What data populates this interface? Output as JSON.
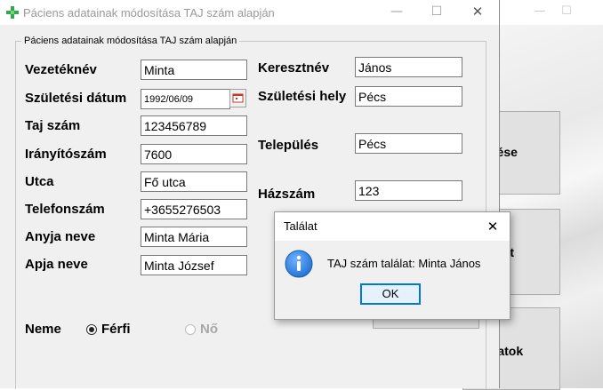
{
  "background_window": {
    "buttons": [
      {
        "label": "zítése"
      },
      {
        "label": "xport"
      },
      {
        "label": "adatok"
      }
    ]
  },
  "dialog": {
    "title": "Páciens adatainak módosítása TAJ szám alapján",
    "group_title": "Páciens adatainak módosítása TAJ szám alapján",
    "fields": {
      "vezeteknev": {
        "label": "Vezetéknév",
        "value": "Minta"
      },
      "szuletesi_datum": {
        "label": "Születési dátum",
        "value": "1992/06/09"
      },
      "taj_szam": {
        "label": "Taj szám",
        "value": "123456789"
      },
      "iranyitoszam": {
        "label": "Irányítószám",
        "value": "7600"
      },
      "utca": {
        "label": "Utca",
        "value": "Fő utca"
      },
      "telefonszam": {
        "label": "Telefonszám",
        "value": "+3655276503"
      },
      "anyja_neve": {
        "label": "Anyja neve",
        "value": "Minta Mária"
      },
      "apja_neve": {
        "label": "Apja neve",
        "value": "Minta József"
      },
      "keresztnev": {
        "label": "Keresztnév",
        "value": "János"
      },
      "szuletesi_hely": {
        "label": "Születési hely",
        "value": "Pécs"
      },
      "telepules": {
        "label": "Település",
        "value": "Pécs"
      },
      "hazszam": {
        "label": "Házszám",
        "value": "123"
      }
    },
    "gender": {
      "label": "Neme",
      "options": [
        {
          "label": "Férfi",
          "selected": true,
          "enabled": true
        },
        {
          "label": "Nő",
          "selected": false,
          "enabled": false
        }
      ]
    }
  },
  "message_box": {
    "title": "Találat",
    "text": "TAJ szám találat: Minta János",
    "ok_label": "OK",
    "icon": "info-icon"
  },
  "colors": {
    "app_icon": "#2fa84f",
    "info_icon": "#1f6fd1",
    "ok_border": "#0078d7"
  }
}
